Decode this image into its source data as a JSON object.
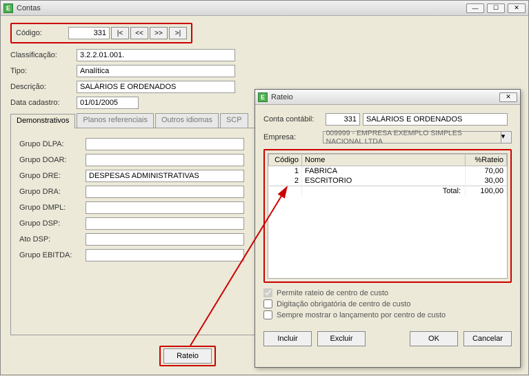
{
  "window": {
    "title": "Contas",
    "icon_text": "E"
  },
  "form": {
    "codigo_label": "Código:",
    "codigo_value": "331",
    "nav_first": "|<",
    "nav_prev": "<<",
    "nav_next": ">>",
    "nav_last": ">|",
    "classificacao_label": "Classificação:",
    "classificacao_value": "3.2.2.01.001.",
    "tipo_label": "Tipo:",
    "tipo_value": "Analítica",
    "descricao_label": "Descrição:",
    "descricao_value": "SALÁRIOS E ORDENADOS",
    "data_cadastro_label": "Data cadastro:",
    "data_cadastro_value": "01/01/2005"
  },
  "tabs": {
    "demonstrativos": "Demonstrativos",
    "planos": "Planos referenciais",
    "outros": "Outros idiomas",
    "scp": "SCP"
  },
  "grupos": {
    "dlpa_label": "Grupo DLPA:",
    "dlpa_value": "",
    "doar_label": "Grupo DOAR:",
    "doar_value": "",
    "dre_label": "Grupo DRE:",
    "dre_value": "DESPESAS ADMINISTRATIVAS",
    "dra_label": "Grupo DRA:",
    "dra_value": "",
    "dmpl_label": "Grupo DMPL:",
    "dmpl_value": "",
    "dsp_label": "Grupo DSP:",
    "dsp_value": "",
    "ato_label": "Ato DSP:",
    "ato_value": "",
    "ebitda_label": "Grupo EBITDA:",
    "ebitda_value": ""
  },
  "rateio_button": "Rateio",
  "dialog": {
    "title": "Rateio",
    "conta_label": "Conta contábil:",
    "conta_code": "331",
    "conta_name": "SALÁRIOS E ORDENADOS",
    "empresa_label": "Empresa:",
    "empresa_value": "009999 - EMPRESA EXEMPLO SIMPLES NACIONAL LTDA",
    "col_codigo": "Código",
    "col_nome": "Nome",
    "col_pct": "%Rateio",
    "rows": [
      {
        "codigo": "1",
        "nome": "FABRICA",
        "pct": "70,00"
      },
      {
        "codigo": "2",
        "nome": "ESCRITORIO",
        "pct": "30,00"
      }
    ],
    "total_label": "Total:",
    "total_value": "100,00",
    "chk_permite": "Permite rateio de centro de custo",
    "chk_digitacao": "Digitação obrigatória de centro de custo",
    "chk_sempre": "Sempre mostrar o lançamento por centro de custo",
    "btn_incluir": "Incluir",
    "btn_excluir": "Excluir",
    "btn_ok": "OK",
    "btn_cancelar": "Cancelar"
  }
}
